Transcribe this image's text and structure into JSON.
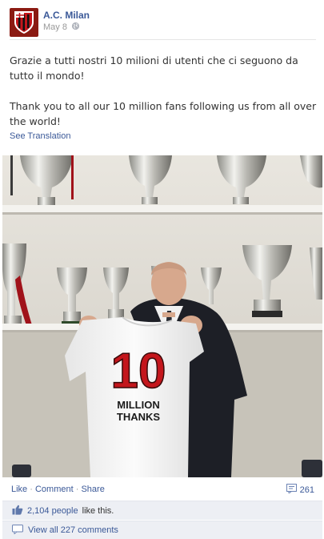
{
  "post": {
    "author": "A.C. Milan",
    "date": "May 8",
    "text_it": "Grazie a tutti nostri 10 milioni di utenti che ci seguono da tutto il mondo!",
    "text_en": "Thank you to all our 10 million fans following us from all over the world!",
    "see_translation": "See Translation"
  },
  "photo": {
    "shirt_number": "10",
    "shirt_line1": "MILLION",
    "shirt_line2": "THANKS"
  },
  "actions": {
    "like": "Like",
    "comment": "Comment",
    "share": "Share",
    "separator": "·",
    "share_count": "261"
  },
  "likes": {
    "count_link": "2,104 people",
    "suffix": "like this."
  },
  "comments": {
    "view_all": "View all 227 comments"
  },
  "colors": {
    "link": "#3b5998",
    "panel": "#edeff4",
    "milan_red": "#c4161c"
  }
}
